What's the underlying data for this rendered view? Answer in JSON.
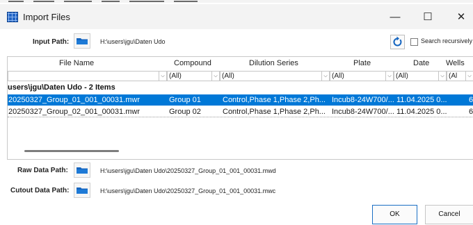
{
  "window": {
    "title": "Import Files",
    "minimize": "—",
    "maximize": "☐",
    "close": "✕"
  },
  "input": {
    "label": "Input Path:",
    "path": "H:\\users\\jgu\\Daten Udo",
    "search_recursively_label": "Search recursively",
    "search_recursively_checked": false
  },
  "grid": {
    "columns": [
      "File Name",
      "Compound",
      "Dilution Series",
      "Plate",
      "Date",
      "Wells"
    ],
    "filters": [
      "",
      "(All)",
      "(All)",
      "(All)",
      "(All)",
      "(Al"
    ],
    "group_label": "\\users\\jgu\\Daten Udo - 2 Items",
    "rows": [
      {
        "file_name": "20250327_Group_01_001_00031.mwr",
        "compound": "Group 01",
        "dilution": "Control,Phase 1,Phase 2,Ph...",
        "plate": "Incub8-24W700/...",
        "date": "11.04.2025 0...",
        "wells": "6",
        "selected": true
      },
      {
        "file_name": "20250327_Group_02_001_00031.mwr",
        "compound": "Group 02",
        "dilution": "Control,Phase 1,Phase 2,Ph...",
        "plate": "Incub8-24W700/...",
        "date": "11.04.2025 0...",
        "wells": "6",
        "selected": false
      }
    ]
  },
  "raw_data": {
    "label": "Raw Data Path:",
    "path": "H:\\users\\jgu\\Daten Udo\\20250327_Group_01_001_00031.mwd"
  },
  "cutout_data": {
    "label": "Cutout Data Path:",
    "path": "H:\\users\\jgu\\Daten Udo\\20250327_Group_01_001_00031.mwc"
  },
  "buttons": {
    "ok": "OK",
    "cancel": "Cancel"
  },
  "colors": {
    "selection": "#0078d7",
    "folder_icon": "#1565c0",
    "refresh_icon": "#1565c0"
  }
}
